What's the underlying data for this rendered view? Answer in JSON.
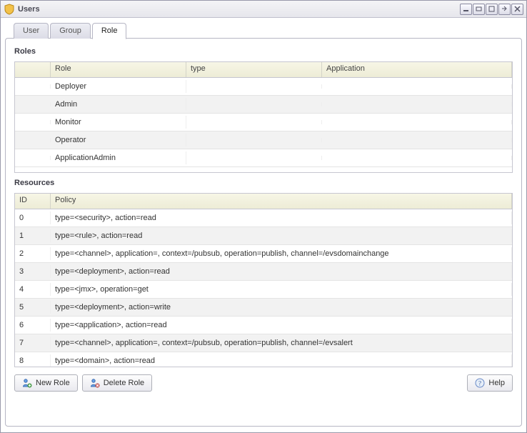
{
  "window": {
    "title": "Users"
  },
  "tabs": [
    {
      "label": "User",
      "active": false
    },
    {
      "label": "Group",
      "active": false
    },
    {
      "label": "Role",
      "active": true
    }
  ],
  "sections": {
    "roles_label": "Roles",
    "resources_label": "Resources"
  },
  "roles": {
    "columns": {
      "c0": "",
      "c1": "Role",
      "c2": "type",
      "c3": "Application"
    },
    "rows": [
      {
        "c0": "",
        "c1": "Deployer",
        "c2": "",
        "c3": ""
      },
      {
        "c0": "",
        "c1": "Admin",
        "c2": "",
        "c3": ""
      },
      {
        "c0": "",
        "c1": "Monitor",
        "c2": "",
        "c3": ""
      },
      {
        "c0": "",
        "c1": "Operator",
        "c2": "",
        "c3": ""
      },
      {
        "c0": "",
        "c1": "ApplicationAdmin",
        "c2": "",
        "c3": ""
      }
    ]
  },
  "resources": {
    "columns": {
      "c0": "ID",
      "c1": "Policy"
    },
    "rows": [
      {
        "id": "0",
        "policy": "type=<security>, action=read"
      },
      {
        "id": "1",
        "policy": "type=<rule>, action=read"
      },
      {
        "id": "2",
        "policy": "type=<channel>, application=, context=/pubsub, operation=publish, channel=/evsdomainchange"
      },
      {
        "id": "3",
        "policy": "type=<deployment>, action=read"
      },
      {
        "id": "4",
        "policy": "type=<jmx>, operation=get"
      },
      {
        "id": "5",
        "policy": "type=<deployment>, action=write"
      },
      {
        "id": "6",
        "policy": "type=<application>, action=read"
      },
      {
        "id": "7",
        "policy": "type=<channel>, application=, context=/pubsub, operation=publish, channel=/evsalert"
      },
      {
        "id": "8",
        "policy": "type=<domain>, action=read"
      }
    ]
  },
  "buttons": {
    "new_role": "New Role",
    "delete_role": "Delete Role",
    "help": "Help"
  }
}
